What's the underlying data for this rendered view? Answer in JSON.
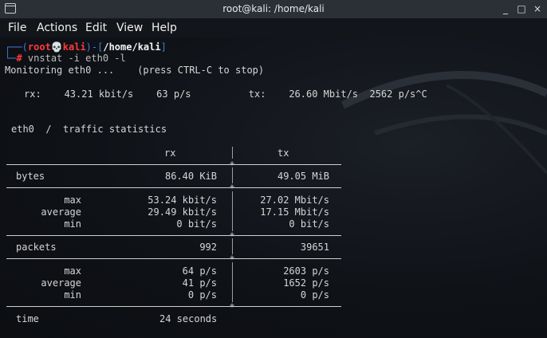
{
  "window": {
    "title": "root@kali: /home/kali",
    "minimize": "_",
    "maximize": "□",
    "close": "×"
  },
  "menu": {
    "file": "File",
    "actions": "Actions",
    "edit": "Edit",
    "view": "View",
    "help": "Help"
  },
  "prompt": {
    "user": "root",
    "host": "kali",
    "path": "/home/kali",
    "command": "vnstat -i eth0 -l"
  },
  "monitor": {
    "status": "Monitoring eth0 ...",
    "hint": "(press CTRL-C to stop)",
    "live": "rx:    43.21 kbit/s    63 p/s          tx:    26.60 Mbit/s  2562 p/s^C"
  },
  "stats": {
    "heading": "eth0  /  traffic statistics",
    "col_rx": "rx",
    "col_tx": "tx",
    "bytes": {
      "label": "bytes",
      "rx": "86.40 KiB",
      "tx": "49.05 MiB"
    },
    "rate": {
      "max": {
        "label": "max",
        "rx": "53.24 kbit/s",
        "tx": "27.02 Mbit/s"
      },
      "average": {
        "label": "average",
        "rx": "29.49 kbit/s",
        "tx": "17.15 Mbit/s"
      },
      "min": {
        "label": "min",
        "rx": "0 bit/s",
        "tx": "0 bit/s"
      }
    },
    "packets": {
      "label": "packets",
      "rx": "992",
      "tx": "39651"
    },
    "pps": {
      "max": {
        "label": "max",
        "rx": "64 p/s",
        "tx": "2603 p/s"
      },
      "average": {
        "label": "average",
        "rx": "41 p/s",
        "tx": "1652 p/s"
      },
      "min": {
        "label": "min",
        "rx": "0 p/s",
        "tx": "0 p/s"
      }
    },
    "time": {
      "label": "time",
      "value": "24 seconds"
    }
  },
  "colors": {
    "prompt_frame": "#3f7bd9",
    "prompt_user": "#ff3b3b",
    "background": "#0f1217",
    "titlebar": "#2b2f36"
  }
}
